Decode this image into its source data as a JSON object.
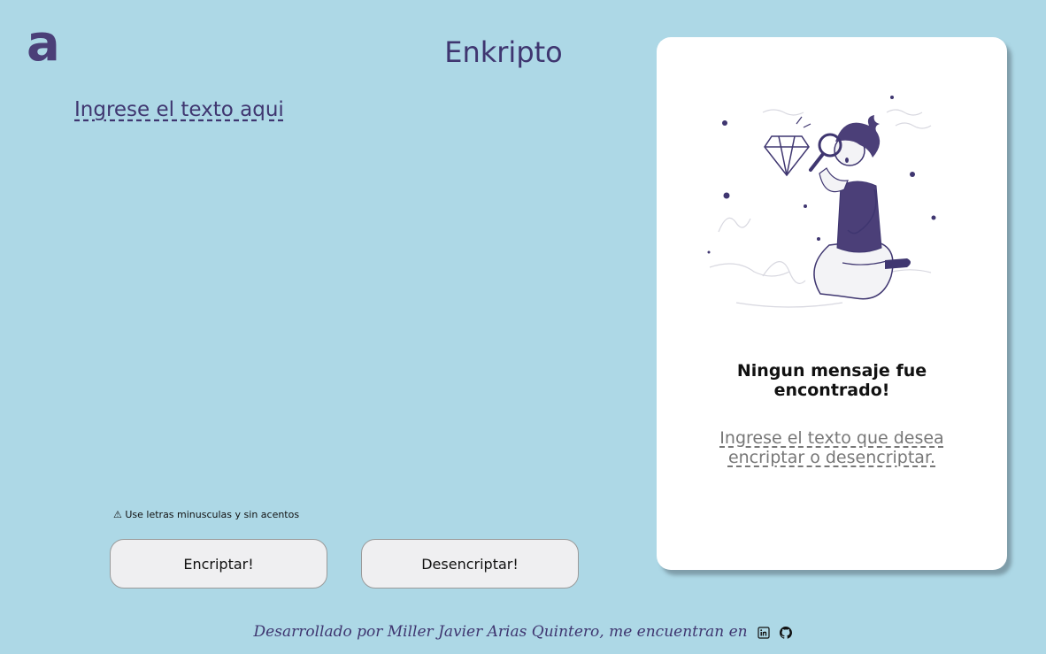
{
  "app": {
    "logo_text": "a",
    "title": "Enkripto"
  },
  "input": {
    "placeholder": "Ingrese el texto aqui",
    "value": ""
  },
  "warning": {
    "icon": "warning-icon",
    "text": "⚠ Use letras minusculas y sin acentos"
  },
  "buttons": {
    "encrypt_label": "Encriptar!",
    "decrypt_label": "Desencriptar!"
  },
  "result_card": {
    "title": "Ningun mensaje fue encontrado!",
    "subtitle": "Ingrese el texto que desea encriptar o desencriptar."
  },
  "footer": {
    "text": "Desarrollado por Miller Javier Arias Quintero, me encuentran en",
    "links": [
      "linkedin-icon",
      "github-icon"
    ]
  },
  "colors": {
    "background": "#add8e6",
    "accent": "#3f3670",
    "card": "#ffffff",
    "button": "#efeff1"
  }
}
